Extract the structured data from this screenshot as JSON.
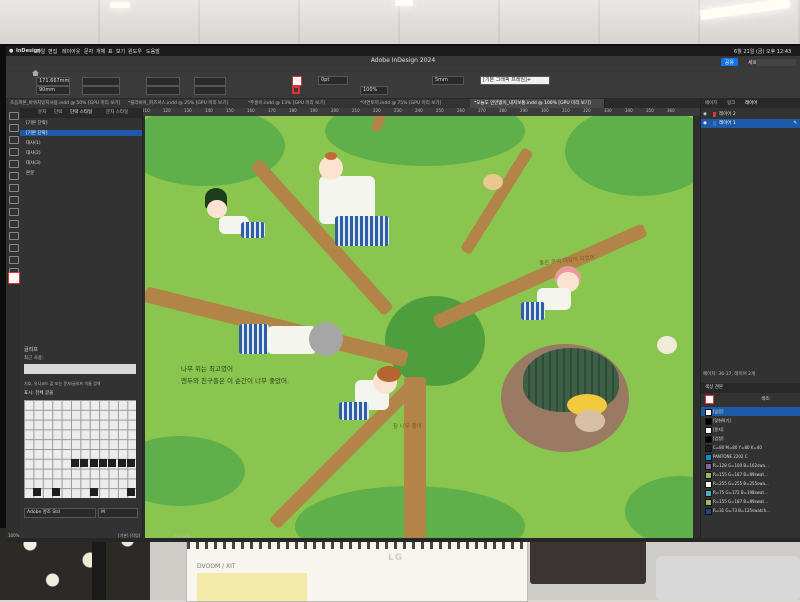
{
  "app": {
    "menubar": [
      "InDesign",
      "파일",
      "편집",
      "레이아웃",
      "문자",
      "개체",
      "표",
      "보기",
      "윈도우",
      "도움말"
    ],
    "window_title": "Adobe InDesign 2024",
    "clock": "6월 21일 (금) 오후 12:43",
    "share_label": "공유",
    "workspace_label": "세로 5",
    "stock_placeholder": "Adobe Stock"
  },
  "control": {
    "x": "90mm",
    "y": "171.667mm",
    "stroke": "0pt",
    "zoom": "100%",
    "gap": "5mm",
    "frame_style": "[기본 그래픽 프레임]+"
  },
  "tabs": [
    {
      "label": "초음파본_바위치있지사용.indd @ 50% [GPU 미리 보기]",
      "active": false
    },
    {
      "label": "*플라비아_퍼즈서스.indd @ 25% [GPU 미리 보기]",
      "active": false
    },
    {
      "label": "*주홍이.indd @ 13% [GPU 미리 보기]",
      "active": false
    },
    {
      "label": "*아연토끼.indd @ 75% [GPU 미리 보기]",
      "active": false
    },
    {
      "label": "*오늘도 민만없이_내지보통.indd @ 100% [GPU 미리 보기]",
      "active": true
    }
  ],
  "ruler": [
    "110",
    "120",
    "130",
    "140",
    "150",
    "160",
    "170",
    "180",
    "190",
    "200",
    "210",
    "220",
    "230",
    "240",
    "250",
    "260",
    "270",
    "280",
    "290",
    "300",
    "310",
    "320",
    "330",
    "340",
    "350",
    "360"
  ],
  "left_panel": {
    "tabs": [
      "문자",
      "단락",
      "단락 스타일",
      "문자 스타일"
    ],
    "active_tab": "단락 스타일",
    "style_header": "[기본 단락]",
    "items": [
      {
        "label": "[기본 단락]",
        "selected": true
      },
      {
        "label": "대사(1)",
        "selected": false
      },
      {
        "label": "대사(2)",
        "selected": false
      },
      {
        "label": "대사(3)",
        "selected": false
      },
      {
        "label": "본문",
        "selected": false
      }
    ]
  },
  "glyphs": {
    "title": "글리프",
    "recent_label": "최근 사용:",
    "hint": "기호, 유니코드 값 또는 문자/글리프 이름 검색",
    "show_label": "표시:",
    "show_value": "전체 글꼴",
    "font": "Adobe 명조 Std",
    "font_style": "M"
  },
  "status": {
    "zoom": "100%",
    "page": "[기본] (작업)",
    "errors": "오류 없음"
  },
  "artwork": {
    "caption_line1": "나무 위는 최고였어",
    "caption_line2": "엔두와 친구들은 이 순간이 너무 좋았어.",
    "note1": "좋은 우리 대장이 되었어",
    "note2": "참 나무 좋아"
  },
  "right_panel": {
    "tabs": [
      "페이지",
      "링크",
      "레이어"
    ],
    "active_tab": "레이어",
    "layers": [
      {
        "label": "레이어 2",
        "color": "#d33b3b",
        "selected": false
      },
      {
        "label": "레이어 1",
        "color": "#3b6fd3",
        "selected": true
      }
    ],
    "page_info": "페이지: 36-37, 레이어 2개",
    "swatches_title": "색상 견본",
    "tint_label": "색조:",
    "swatches": [
      {
        "label": "[없음]",
        "color": "#ffffff",
        "selected": true
      },
      {
        "label": "[맞춰찍기]",
        "color": "#000000",
        "selected": false
      },
      {
        "label": "[용지]",
        "color": "#ffffff",
        "selected": false
      },
      {
        "label": "[검정]",
        "color": "#000000",
        "selected": false
      },
      {
        "label": "C=80 M=80 Y=80 K=40",
        "color": "#1f1f1f",
        "selected": false
      },
      {
        "label": "PANTONE 2202 C",
        "color": "#0f8fd6",
        "selected": false
      },
      {
        "label": "R=128 G=100 B=162swa...",
        "color": "#8064a2",
        "selected": false
      },
      {
        "label": "R=155 G=187 B=89swat...",
        "color": "#9bbb59",
        "selected": false
      },
      {
        "label": "R=255 G=255 B=255swa...",
        "color": "#ffffff",
        "selected": false
      },
      {
        "label": "R=75 G=172 B=198swat...",
        "color": "#4bacc6",
        "selected": false
      },
      {
        "label": "R=155 G=187 B=89swat...",
        "color": "#9bbb59",
        "selected": false
      },
      {
        "label": "R=31 G=73 B=125swatch...",
        "color": "#1f497d",
        "selected": false
      }
    ]
  },
  "monitor": {
    "brand": "LG"
  },
  "notebook": {
    "label": "DVOOM / XIT"
  }
}
